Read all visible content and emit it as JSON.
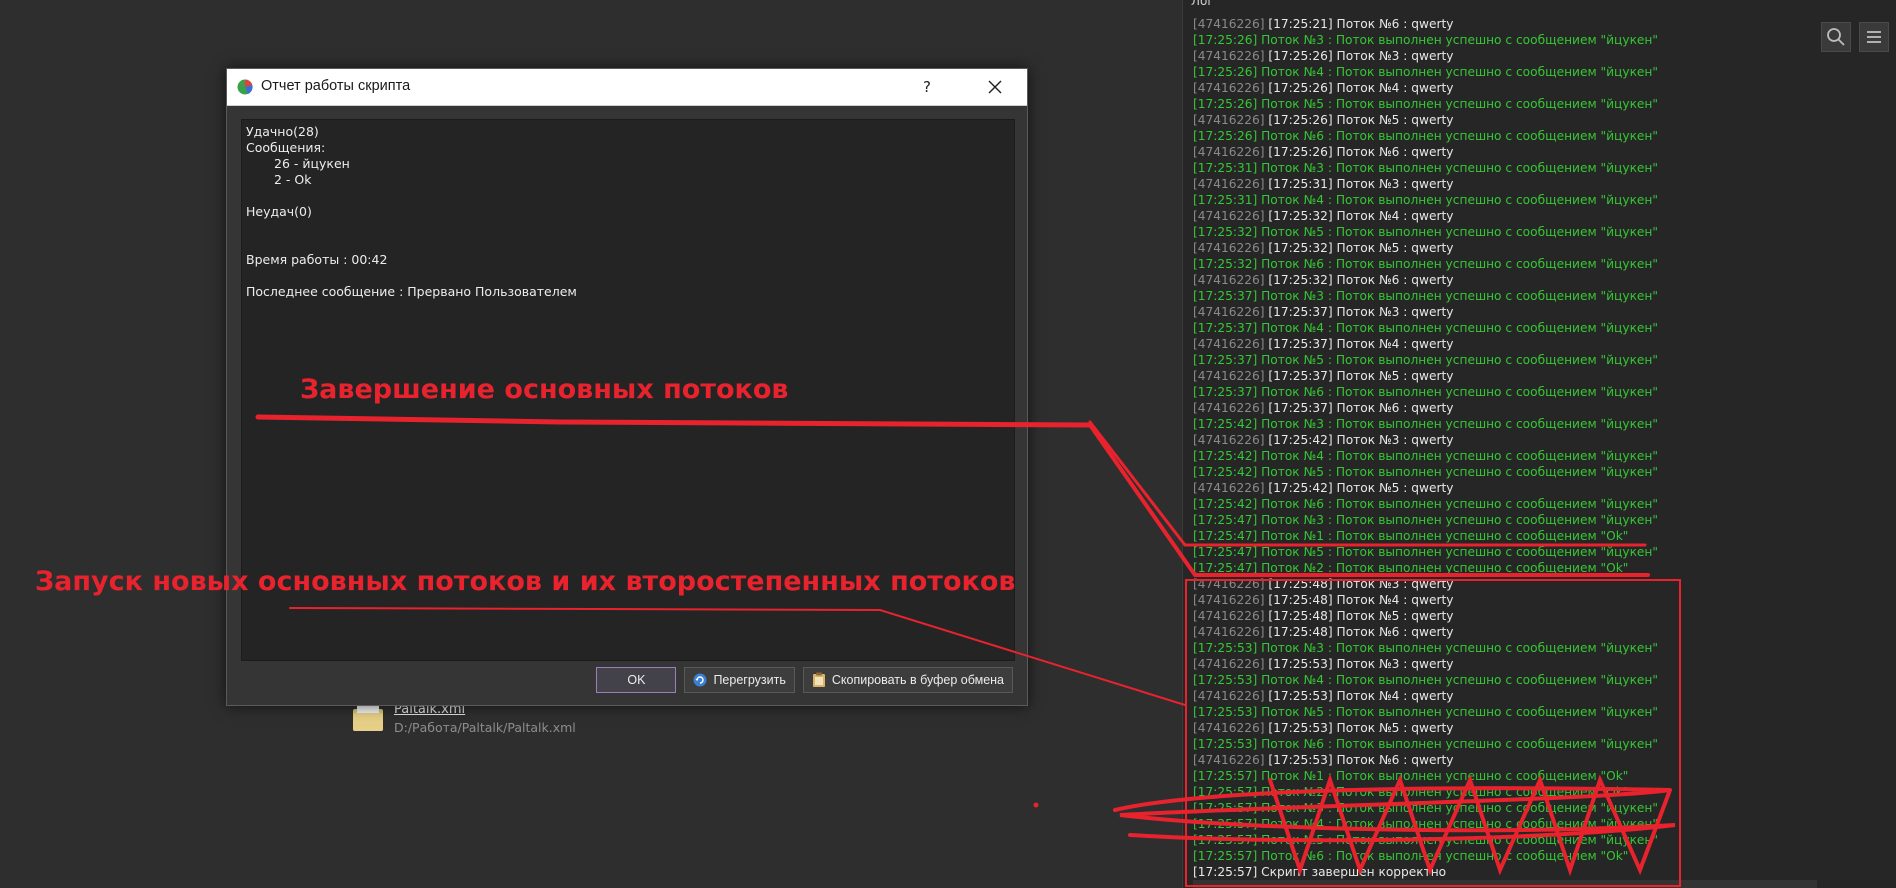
{
  "log": {
    "title": "Лог",
    "lines": [
      {
        "id": "[47416226]",
        "time": "[17:25:21]",
        "msg": "Поток №6 : qwerty",
        "ok": false
      },
      {
        "id": "",
        "time": "[17:25:26]",
        "msg": "Поток №3 : Поток выполнен успешно с сообщением \"йцукен\"",
        "ok": true
      },
      {
        "id": "[47416226]",
        "time": "[17:25:26]",
        "msg": "Поток №3 : qwerty",
        "ok": false
      },
      {
        "id": "",
        "time": "[17:25:26]",
        "msg": "Поток №4 : Поток выполнен успешно с сообщением \"йцукен\"",
        "ok": true
      },
      {
        "id": "[47416226]",
        "time": "[17:25:26]",
        "msg": "Поток №4 : qwerty",
        "ok": false
      },
      {
        "id": "",
        "time": "[17:25:26]",
        "msg": "Поток №5 : Поток выполнен успешно с сообщением \"йцукен\"",
        "ok": true
      },
      {
        "id": "[47416226]",
        "time": "[17:25:26]",
        "msg": "Поток №5 : qwerty",
        "ok": false
      },
      {
        "id": "",
        "time": "[17:25:26]",
        "msg": "Поток №6 : Поток выполнен успешно с сообщением \"йцукен\"",
        "ok": true
      },
      {
        "id": "[47416226]",
        "time": "[17:25:26]",
        "msg": "Поток №6 : qwerty",
        "ok": false
      },
      {
        "id": "",
        "time": "[17:25:31]",
        "msg": "Поток №3 : Поток выполнен успешно с сообщением \"йцукен\"",
        "ok": true
      },
      {
        "id": "[47416226]",
        "time": "[17:25:31]",
        "msg": "Поток №3 : qwerty",
        "ok": false
      },
      {
        "id": "",
        "time": "[17:25:31]",
        "msg": "Поток №4 : Поток выполнен успешно с сообщением \"йцукен\"",
        "ok": true
      },
      {
        "id": "[47416226]",
        "time": "[17:25:32]",
        "msg": "Поток №4 : qwerty",
        "ok": false
      },
      {
        "id": "",
        "time": "[17:25:32]",
        "msg": "Поток №5 : Поток выполнен успешно с сообщением \"йцукен\"",
        "ok": true
      },
      {
        "id": "[47416226]",
        "time": "[17:25:32]",
        "msg": "Поток №5 : qwerty",
        "ok": false
      },
      {
        "id": "",
        "time": "[17:25:32]",
        "msg": "Поток №6 : Поток выполнен успешно с сообщением \"йцукен\"",
        "ok": true
      },
      {
        "id": "[47416226]",
        "time": "[17:25:32]",
        "msg": "Поток №6 : qwerty",
        "ok": false
      },
      {
        "id": "",
        "time": "[17:25:37]",
        "msg": "Поток №3 : Поток выполнен успешно с сообщением \"йцукен\"",
        "ok": true
      },
      {
        "id": "[47416226]",
        "time": "[17:25:37]",
        "msg": "Поток №3 : qwerty",
        "ok": false
      },
      {
        "id": "",
        "time": "[17:25:37]",
        "msg": "Поток №4 : Поток выполнен успешно с сообщением \"йцукен\"",
        "ok": true
      },
      {
        "id": "[47416226]",
        "time": "[17:25:37]",
        "msg": "Поток №4 : qwerty",
        "ok": false
      },
      {
        "id": "",
        "time": "[17:25:37]",
        "msg": "Поток №5 : Поток выполнен успешно с сообщением \"йцукен\"",
        "ok": true
      },
      {
        "id": "[47416226]",
        "time": "[17:25:37]",
        "msg": "Поток №5 : qwerty",
        "ok": false
      },
      {
        "id": "",
        "time": "[17:25:37]",
        "msg": "Поток №6 : Поток выполнен успешно с сообщением \"йцукен\"",
        "ok": true
      },
      {
        "id": "[47416226]",
        "time": "[17:25:37]",
        "msg": "Поток №6 : qwerty",
        "ok": false
      },
      {
        "id": "",
        "time": "[17:25:42]",
        "msg": "Поток №3 : Поток выполнен успешно с сообщением \"йцукен\"",
        "ok": true
      },
      {
        "id": "[47416226]",
        "time": "[17:25:42]",
        "msg": "Поток №3 : qwerty",
        "ok": false
      },
      {
        "id": "",
        "time": "[17:25:42]",
        "msg": "Поток №4 : Поток выполнен успешно с сообщением \"йцукен\"",
        "ok": true
      },
      {
        "id": "",
        "time": "[17:25:42]",
        "msg": "Поток №5 : Поток выполнен успешно с сообщением \"йцукен\"",
        "ok": true
      },
      {
        "id": "[47416226]",
        "time": "[17:25:42]",
        "msg": "Поток №5 : qwerty",
        "ok": false
      },
      {
        "id": "",
        "time": "[17:25:42]",
        "msg": "Поток №6 : Поток выполнен успешно с сообщением \"йцукен\"",
        "ok": true
      },
      {
        "id": "",
        "time": "[17:25:47]",
        "msg": "Поток №3 : Поток выполнен успешно с сообщением \"йцукен\"",
        "ok": true
      },
      {
        "id": "",
        "time": "[17:25:47]",
        "msg": "Поток №1 : Поток выполнен успешно с сообщением \"Ok\"",
        "ok": true
      },
      {
        "id": "",
        "time": "[17:25:47]",
        "msg": "Поток №5 : Поток выполнен успешно с сообщением \"йцукен\"",
        "ok": true
      },
      {
        "id": "",
        "time": "[17:25:47]",
        "msg": "Поток №2 : Поток выполнен успешно с сообщением \"Ok\"",
        "ok": true
      },
      {
        "id": "[47416226]",
        "time": "[17:25:48]",
        "msg": "Поток №3 : qwerty",
        "ok": false
      },
      {
        "id": "[47416226]",
        "time": "[17:25:48]",
        "msg": "Поток №4 : qwerty",
        "ok": false
      },
      {
        "id": "[47416226]",
        "time": "[17:25:48]",
        "msg": "Поток №5 : qwerty",
        "ok": false
      },
      {
        "id": "[47416226]",
        "time": "[17:25:48]",
        "msg": "Поток №6 : qwerty",
        "ok": false
      },
      {
        "id": "",
        "time": "[17:25:53]",
        "msg": "Поток №3 : Поток выполнен успешно с сообщением \"йцукен\"",
        "ok": true
      },
      {
        "id": "[47416226]",
        "time": "[17:25:53]",
        "msg": "Поток №3 : qwerty",
        "ok": false
      },
      {
        "id": "",
        "time": "[17:25:53]",
        "msg": "Поток №4 : Поток выполнен успешно с сообщением \"йцукен\"",
        "ok": true
      },
      {
        "id": "[47416226]",
        "time": "[17:25:53]",
        "msg": "Поток №4 : qwerty",
        "ok": false
      },
      {
        "id": "",
        "time": "[17:25:53]",
        "msg": "Поток №5 : Поток выполнен успешно с сообщением \"йцукен\"",
        "ok": true
      },
      {
        "id": "[47416226]",
        "time": "[17:25:53]",
        "msg": "Поток №5 : qwerty",
        "ok": false
      },
      {
        "id": "",
        "time": "[17:25:53]",
        "msg": "Поток №6 : Поток выполнен успешно с сообщением \"йцукен\"",
        "ok": true
      },
      {
        "id": "[47416226]",
        "time": "[17:25:53]",
        "msg": "Поток №6 : qwerty",
        "ok": false
      },
      {
        "id": "",
        "time": "[17:25:57]",
        "msg": "Поток №1 : Поток выполнен успешно с сообщением \"Ok\"",
        "ok": true
      },
      {
        "id": "",
        "time": "[17:25:57]",
        "msg": "Поток №2 : Поток выполнен успешно с сообщением \"Ok\"",
        "ok": true
      },
      {
        "id": "",
        "time": "[17:25:57]",
        "msg": "Поток №3 : Поток выполнен успешно с сообщением \"йцукен\"",
        "ok": true
      },
      {
        "id": "",
        "time": "[17:25:57]",
        "msg": "Поток №4 : Поток выполнен успешно с сообщением \"йцукен\"",
        "ok": true
      },
      {
        "id": "",
        "time": "[17:25:57]",
        "msg": "Поток №5 : Поток выполнен успешно с сообщением \"йцукен\"",
        "ok": true
      },
      {
        "id": "",
        "time": "[17:25:57]",
        "msg": "Поток №6 : Поток выполнен успешно с сообщением \"Ok\"",
        "ok": true
      },
      {
        "id": "",
        "time": "[17:25:57]",
        "msg": "Скрипт завершен корректно",
        "ok": false
      }
    ],
    "tools": {
      "search_icon": "search-icon",
      "menu_icon": "menu-icon"
    }
  },
  "file": {
    "name": "Paltalk.xml",
    "path": "D:/Работа/Paltalk/Paltalk.xml"
  },
  "dialog": {
    "title": "Отчет работы скрипта",
    "help": "?",
    "report": {
      "success": "Удачно(28)",
      "messages_label": "Сообщения:",
      "msg1": "26 - йцукен",
      "msg2": "2 - Ok",
      "failures": "Неудач(0)",
      "work_time": "Время работы : 00:42",
      "last_message": "Последнее сообщение : Прервано Пользователем"
    },
    "buttons": {
      "ok": "OK",
      "restart": "Перегрузить",
      "copy": "Скопировать в буфер обмена"
    }
  },
  "annotations": {
    "label1": "Завершение основных потоков",
    "label2": "Запуск новых основных потоков и их второстепенных потоков",
    "color": "#e8232e"
  },
  "colors": {
    "log_ok": "#35c735",
    "log_text": "#e8e8e8",
    "log_id": "#8a8a8a"
  }
}
